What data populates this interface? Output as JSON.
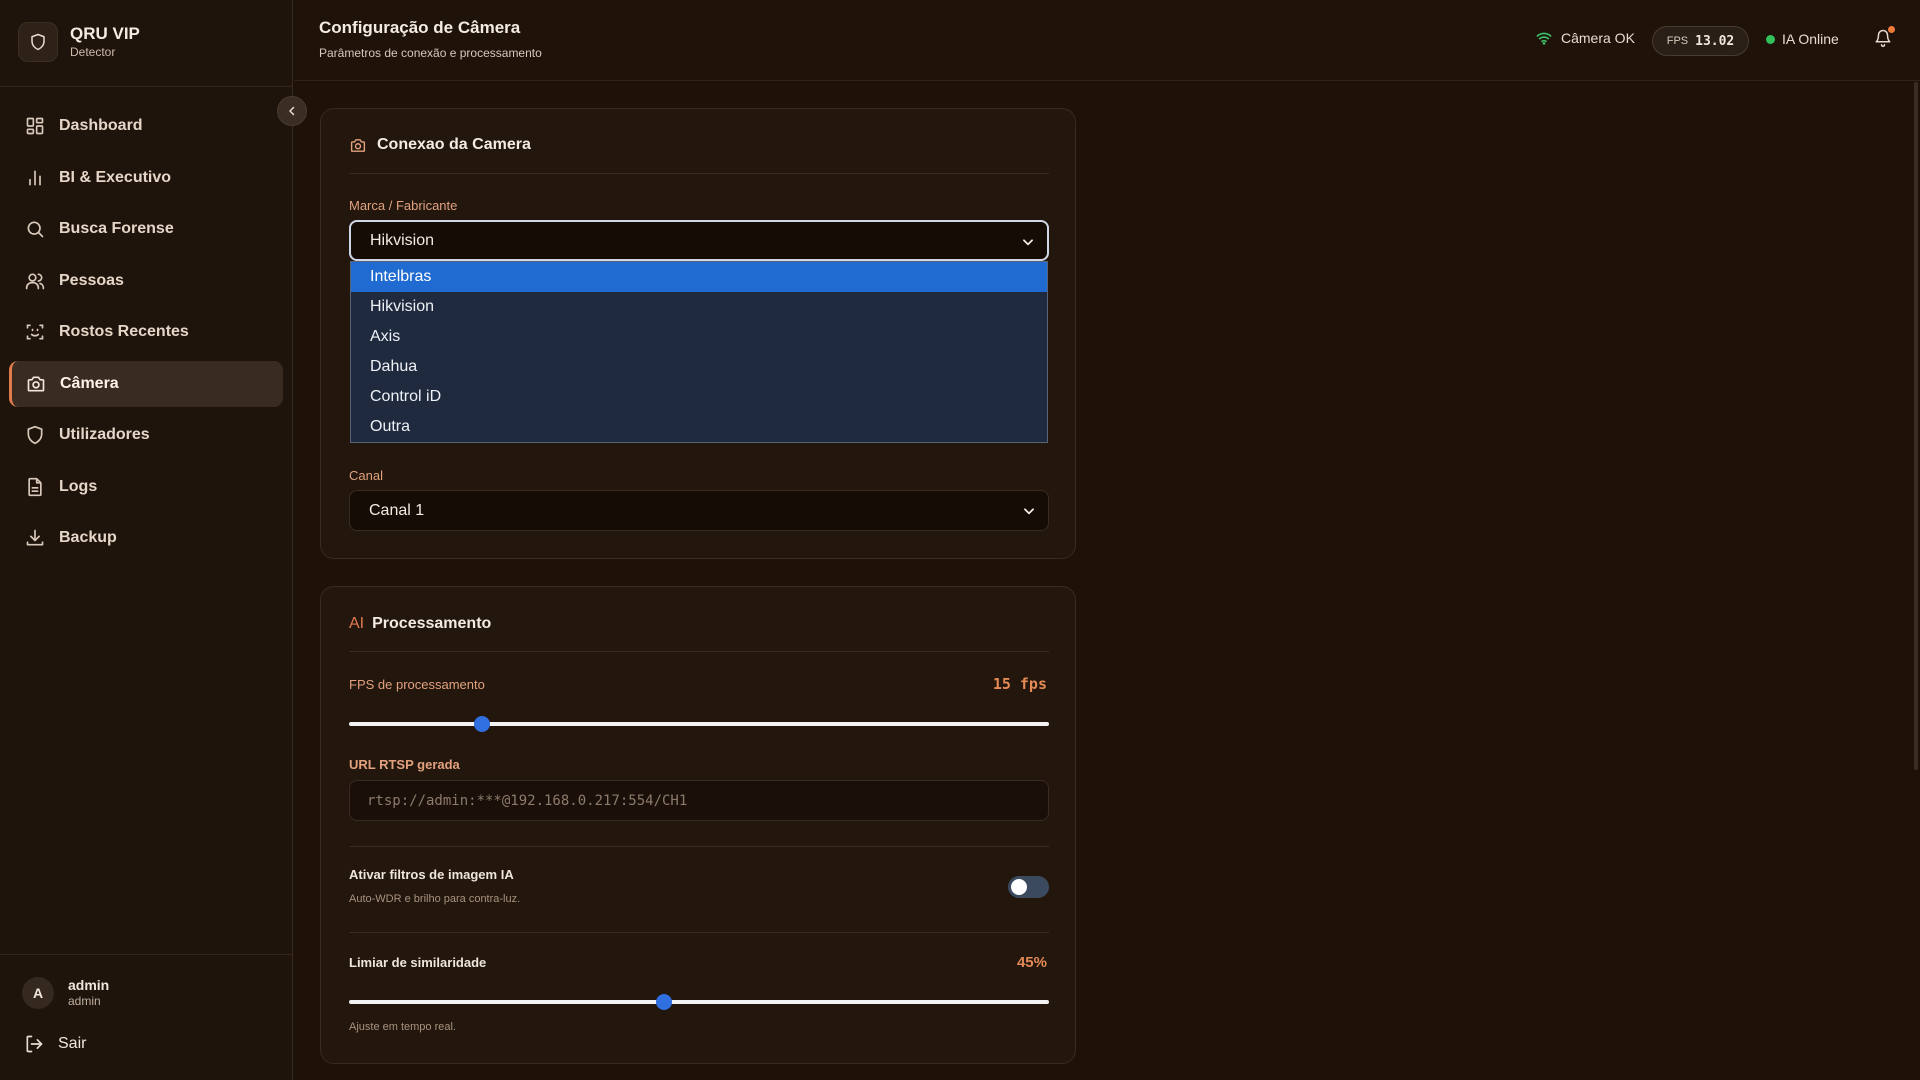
{
  "brand": {
    "name": "QRU VIP",
    "subtitle": "Detector"
  },
  "sidebar": {
    "items": [
      {
        "label": "Dashboard",
        "icon": "dashboard-icon"
      },
      {
        "label": "BI & Executivo",
        "icon": "bar-chart-icon"
      },
      {
        "label": "Busca Forense",
        "icon": "search-icon"
      },
      {
        "label": "Pessoas",
        "icon": "users-icon"
      },
      {
        "label": "Rostos Recentes",
        "icon": "face-scan-icon"
      },
      {
        "label": "Câmera",
        "icon": "camera-icon",
        "active": true
      },
      {
        "label": "Utilizadores",
        "icon": "shield-icon"
      },
      {
        "label": "Logs",
        "icon": "file-icon"
      },
      {
        "label": "Backup",
        "icon": "download-icon"
      }
    ],
    "user": {
      "initial": "A",
      "name": "admin",
      "role": "admin"
    },
    "logout_label": "Sair"
  },
  "header": {
    "title": "Configuração de Câmera",
    "subtitle": "Parâmetros de conexão e processamento",
    "camera_status": "Câmera OK",
    "fps_label": "FPS",
    "fps_value": "13.02",
    "ia_status": "IA Online"
  },
  "connection_card": {
    "title": "Conexao da Camera",
    "brand_label": "Marca / Fabricante",
    "brand_selected": "Hikvision",
    "brand_options": [
      "Intelbras",
      "Hikvision",
      "Axis",
      "Dahua",
      "Control iD",
      "Outra"
    ],
    "brand_highlighted": "Intelbras",
    "channel_label": "Canal",
    "channel_selected": "Canal 1"
  },
  "processing_card": {
    "ai_prefix": "AI",
    "title": "Processamento",
    "fps_label": "FPS de processamento",
    "fps_value": "15 fps",
    "fps_slider_fraction": 0.19,
    "url_label": "URL RTSP gerada",
    "url_value": "rtsp://admin:***@192.168.0.217:554/CH1",
    "filters_label": "Ativar filtros de imagem IA",
    "filters_hint": "Auto-WDR e brilho para contra-luz.",
    "filters_enabled": false,
    "similarity_label": "Limiar de similaridade",
    "similarity_value": "45%",
    "similarity_fraction": 0.45,
    "similarity_hint": "Ajuste em tempo real."
  },
  "colors": {
    "accent": "#e07b4e",
    "slider_blue": "#2f6fe0",
    "online_green": "#33c15a",
    "dropdown_selected": "#1f6bd1"
  }
}
